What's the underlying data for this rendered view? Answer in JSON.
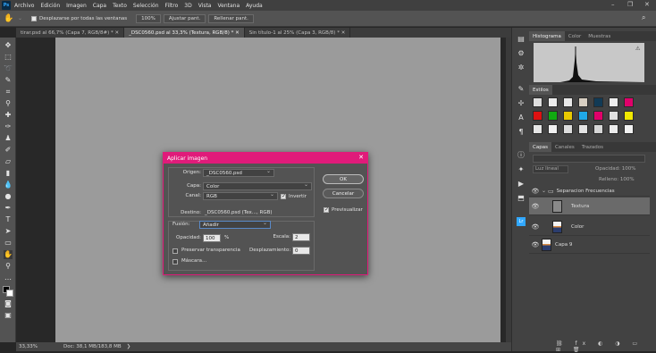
{
  "app": {
    "logo": "Ps"
  },
  "menu": [
    "Archivo",
    "Edición",
    "Imagen",
    "Capa",
    "Texto",
    "Selección",
    "Filtro",
    "3D",
    "Vista",
    "Ventana",
    "Ayuda"
  ],
  "options": {
    "scroll_all_label": "Desplazarse por todas las ventanas",
    "zoom_value": "100%",
    "fit_label": "Ajustar pant.",
    "fill_label": "Rellenar pant."
  },
  "tabs": [
    {
      "label": "tirar.psd al 66,7% (Capa 7, RGB/8#) * ✕",
      "active": false
    },
    {
      "label": "_DSC0560.psd al 33,3% (Textura, RGB/8) * ✕",
      "active": true
    },
    {
      "label": "Sin título-1 al 25% (Capa 3, RGB/8) * ✕",
      "active": false
    }
  ],
  "status": {
    "zoom": "33,33%",
    "doc": "Doc: 38,1 MB/183,8 MB"
  },
  "panels": {
    "histogram_tabs": [
      "Histograma",
      "Color",
      "Muestras"
    ],
    "styles_tab": "Estilos",
    "layers_tabs": [
      "Capas",
      "Canales",
      "Trazados"
    ],
    "kind_label": "Luz lineal",
    "opacity_label": "Opacidad: 100%",
    "fill_label": "Relleno: 100%",
    "layers": [
      {
        "name": "Separacion Frecuencias",
        "type": "group"
      },
      {
        "name": "Textura",
        "type": "layer",
        "selected": true
      },
      {
        "name": "Color",
        "type": "layer"
      },
      {
        "name": "Capa 9",
        "type": "layer"
      }
    ]
  },
  "style_colors": {
    "row1": [
      "#dedede",
      "#ececec",
      "#e8e8e8",
      "#d8cfc2",
      "#123a55",
      "#eeeeee",
      "#e0006a"
    ],
    "row2": [
      "#dd1111",
      "#11aa11",
      "#e8c800",
      "#1fa8e8",
      "#e0006a",
      "#e0e0e0",
      "#f0e800"
    ],
    "row3": [
      "#e6e6e6",
      "#f0f0f0",
      "#dcdcdc",
      "#e4e4e4",
      "#d6d6d6",
      "#ececec",
      "#f2f2f2"
    ]
  },
  "dialog": {
    "title": "Aplicar imagen",
    "origen_label": "Origen:",
    "origen_value": "_DSC0560.psd",
    "capa_label": "Capa:",
    "capa_value": "Color",
    "canal_label": "Canal:",
    "canal_value": "RGB",
    "invertir_label": "Invertir",
    "destino_label": "Destino:",
    "destino_value": "_DSC0560.psd (Tex..., RGB)",
    "fusion_label": "Fusión:",
    "fusion_value": "Añadir",
    "opacidad_label": "Opacidad:",
    "opacidad_value": "100",
    "opacidad_unit": "%",
    "escala_label": "Escala:",
    "escala_value": "2",
    "desplazamiento_label": "Desplazamiento:",
    "desplazamiento_value": "0",
    "preservar_label": "Preservar transparencia",
    "mascara_label": "Máscara...",
    "ok_label": "OK",
    "cancel_label": "Cancelar",
    "preview_label": "Previsualizar"
  }
}
